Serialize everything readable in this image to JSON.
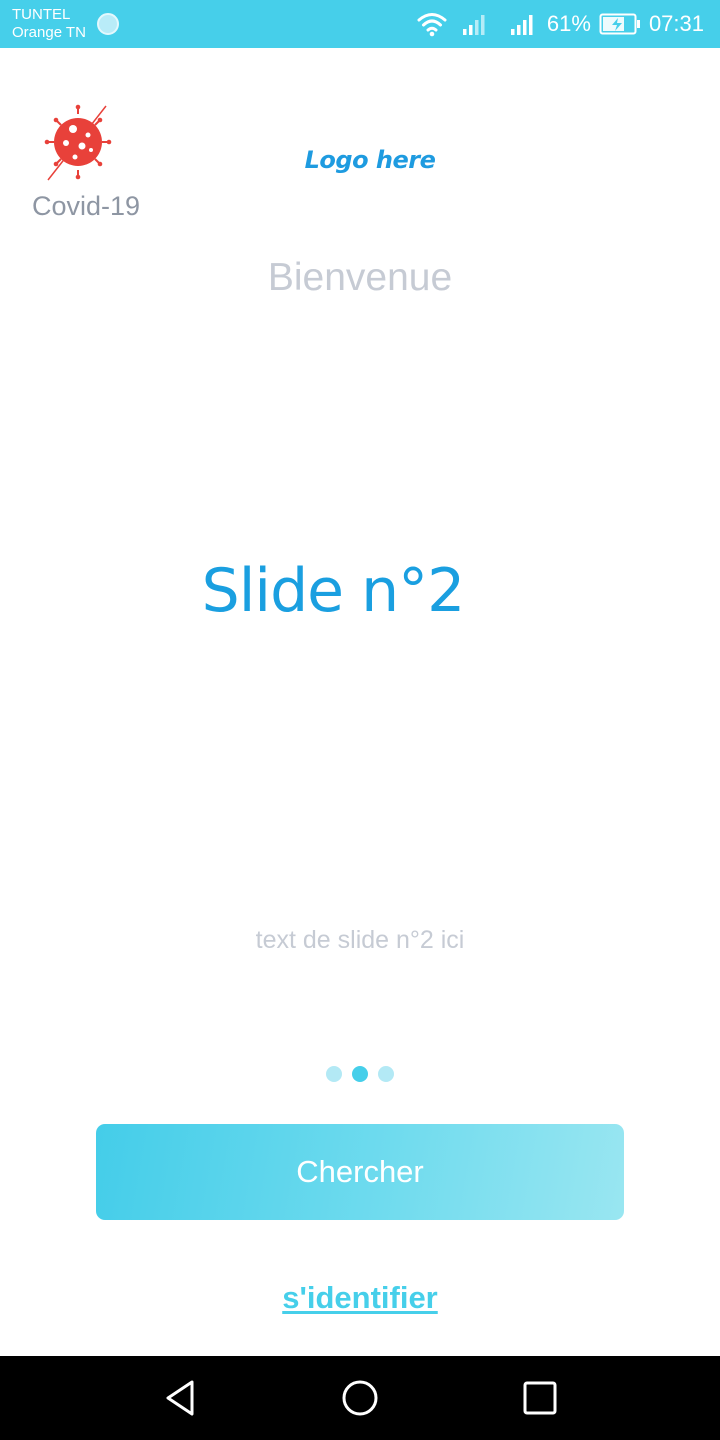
{
  "status_bar": {
    "carrier_1": "TUNTEL",
    "carrier_2": "Orange TN",
    "battery": "61%",
    "time": "07:31",
    "icons": [
      "wifi-icon",
      "signal-icon",
      "signal-icon",
      "battery-charging-icon"
    ],
    "background": "#46cfea"
  },
  "header": {
    "app_label": "Covid-19",
    "logo_text": "Logo here",
    "welcome": "Bienvenue"
  },
  "slide": {
    "title": "Slide n°2",
    "text": "text de slide n°2 ici",
    "current_page": 2,
    "total_pages": 3
  },
  "actions": {
    "search_label": "Chercher",
    "login_label": "s'identifier"
  },
  "nav_bar": {
    "icons": [
      "back-icon",
      "home-icon",
      "recents-icon"
    ]
  },
  "colors": {
    "accent": "#46cfea",
    "title": "#1a9fe0",
    "virus": "#e8413a",
    "muted_text": "#c6cbd4"
  }
}
